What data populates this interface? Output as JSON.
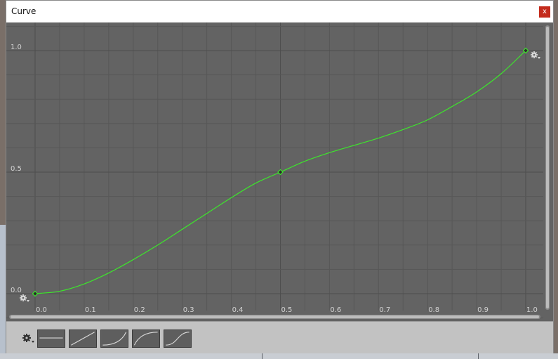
{
  "window": {
    "title": "Curve",
    "close_label": "x"
  },
  "colors": {
    "plot_bg": "#636363",
    "grid_minor": "#575757",
    "grid_major": "#4e4e4e",
    "curve": "#3de62c",
    "label": "#d2d2d2",
    "preset_bg": "#5e5e5e",
    "preset_line": "#d9d9d9"
  },
  "chart_data": {
    "type": "line",
    "xlim": [
      0.0,
      1.0
    ],
    "ylim": [
      0.0,
      1.0
    ],
    "x_ticks": [
      "0.0",
      "0.1",
      "0.2",
      "0.3",
      "0.4",
      "0.5",
      "0.6",
      "0.7",
      "0.8",
      "0.9",
      "1.0"
    ],
    "x_tick_values": [
      0.0,
      0.1,
      0.2,
      0.3,
      0.4,
      0.5,
      0.6,
      0.7,
      0.8,
      0.9,
      1.0
    ],
    "y_ticks": [
      "0.0",
      "0.5",
      "1.0"
    ],
    "y_tick_values": [
      0.0,
      0.5,
      1.0
    ],
    "grid": true,
    "keys": [
      {
        "x": 0.0,
        "y": 0.0
      },
      {
        "x": 0.5,
        "y": 0.5
      },
      {
        "x": 1.0,
        "y": 1.0
      }
    ],
    "curve_points": [
      {
        "x": 0.0,
        "y": 0.0
      },
      {
        "x": 0.05,
        "y": 0.01
      },
      {
        "x": 0.1,
        "y": 0.04
      },
      {
        "x": 0.15,
        "y": 0.085
      },
      {
        "x": 0.2,
        "y": 0.14
      },
      {
        "x": 0.25,
        "y": 0.2
      },
      {
        "x": 0.3,
        "y": 0.265
      },
      {
        "x": 0.35,
        "y": 0.33
      },
      {
        "x": 0.4,
        "y": 0.395
      },
      {
        "x": 0.45,
        "y": 0.455
      },
      {
        "x": 0.5,
        "y": 0.5
      },
      {
        "x": 0.55,
        "y": 0.545
      },
      {
        "x": 0.6,
        "y": 0.58
      },
      {
        "x": 0.65,
        "y": 0.61
      },
      {
        "x": 0.7,
        "y": 0.64
      },
      {
        "x": 0.75,
        "y": 0.675
      },
      {
        "x": 0.8,
        "y": 0.715
      },
      {
        "x": 0.85,
        "y": 0.77
      },
      {
        "x": 0.9,
        "y": 0.83
      },
      {
        "x": 0.95,
        "y": 0.905
      },
      {
        "x": 1.0,
        "y": 1.0
      }
    ]
  },
  "presets": [
    {
      "name": "flat"
    },
    {
      "name": "linear"
    },
    {
      "name": "ease-in"
    },
    {
      "name": "ease-out"
    },
    {
      "name": "ease-in-out"
    }
  ],
  "icons": {
    "settings": "gear-icon",
    "key_menu": "gear-icon"
  }
}
